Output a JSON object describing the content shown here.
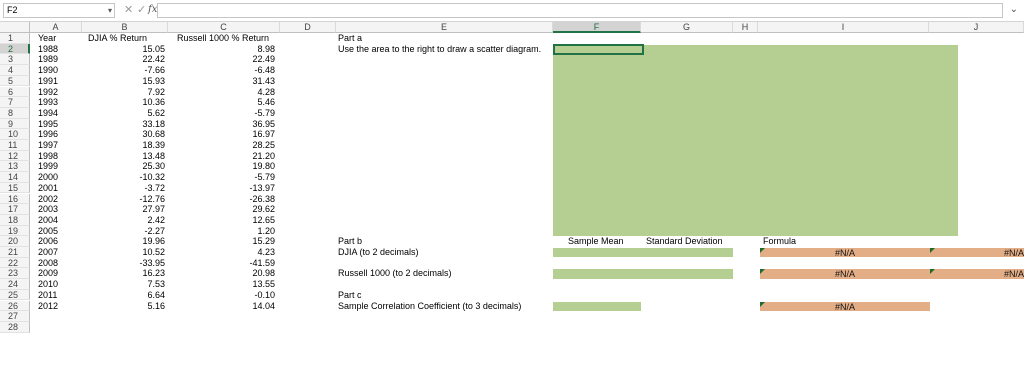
{
  "formula_bar": {
    "name_box": "F2",
    "name_box_arrow": "chevron-down-icon",
    "cancel_icon": "✕",
    "confirm_icon": "✓",
    "fx_label": "fx",
    "formula": "",
    "expand_icon": "chevron-down-icon"
  },
  "columns": [
    "A",
    "B",
    "C",
    "D",
    "E",
    "F",
    "G",
    "H",
    "I",
    "J"
  ],
  "selected_column": "F",
  "selected_row": 2,
  "rows": [
    1,
    2,
    3,
    4,
    5,
    6,
    7,
    8,
    9,
    10,
    11,
    12,
    13,
    14,
    15,
    16,
    17,
    18,
    19,
    20,
    21,
    22,
    23,
    24,
    25,
    26,
    27,
    28
  ],
  "headers": {
    "year": "Year",
    "djia": "DJIA % Return",
    "russell": "Russell 1000 % Return"
  },
  "years": [
    "1988",
    "1989",
    "1990",
    "1991",
    "1992",
    "1993",
    "1994",
    "1995",
    "1996",
    "1997",
    "1998",
    "1999",
    "2000",
    "2001",
    "2002",
    "2003",
    "2004",
    "2005",
    "2006",
    "2007",
    "2008",
    "2009",
    "2010",
    "2011",
    "2012"
  ],
  "djia": [
    "15.05",
    "22.42",
    "-7.66",
    "15.93",
    "7.92",
    "10.36",
    "5.62",
    "33.18",
    "30.68",
    "18.39",
    "13.48",
    "25.30",
    "-10.32",
    "-3.72",
    "-12.76",
    "27.97",
    "2.42",
    "-2.27",
    "19.96",
    "10.52",
    "-33.95",
    "16.23",
    "7.53",
    "6.64",
    "5.16"
  ],
  "russell": [
    "8.98",
    "22.49",
    "-6.48",
    "31.43",
    "4.28",
    "5.46",
    "-5.79",
    "36.95",
    "16.97",
    "28.25",
    "21.20",
    "19.80",
    "-5.79",
    "-13.97",
    "-26.38",
    "29.62",
    "12.65",
    "1.20",
    "15.29",
    "4.23",
    "-41.59",
    "20.98",
    "13.55",
    "-0.10",
    "14.04"
  ],
  "part_a": {
    "title": "Part a",
    "instruction": "Use the area to the right to draw a scatter diagram."
  },
  "part_b": {
    "title": "Part b",
    "sample_mean_header": "Sample Mean",
    "std_dev_header": "Standard Deviation",
    "formula_header": "Formula",
    "djia_label": "DJIA (to 2 decimals)",
    "russell_label": "Russell 1000 (to 2 decimals)",
    "na": "#N/A"
  },
  "part_c": {
    "title": "Part c",
    "label": "Sample Correlation Coefficient (to 3 decimals)",
    "na": "#N/A"
  },
  "colors": {
    "input_green": "#b5cf92",
    "formula_orange": "#e3ae86",
    "selection": "#217346"
  }
}
